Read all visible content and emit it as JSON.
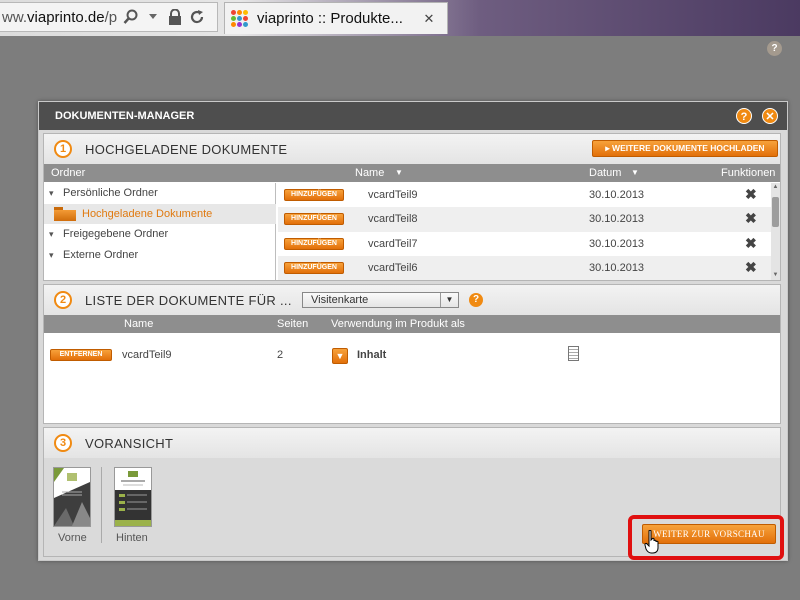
{
  "browser": {
    "url_prefix": "ww.",
    "url_host": "viaprinto.de",
    "url_rest": "/p",
    "tab_title": "viaprinto :: Produkte...",
    "tab_close": "✕"
  },
  "colors": {
    "accent_orange": "#f08a12",
    "title_bar": "#4e4e4e",
    "highlight_red": "#e01010"
  },
  "dialog": {
    "title": "DOKUMENTEN-MANAGER",
    "help_label": "?",
    "close_label": "✕"
  },
  "section1": {
    "number": "1",
    "title": "HOCHGELADENE DOKUMENTE",
    "upload_button": "WEITERE DOKUMENTE HOCHLADEN",
    "columns": {
      "folder": "Ordner",
      "name": "Name",
      "date": "Datum",
      "functions": "Funktionen"
    },
    "folders": [
      {
        "label": "Persönliche Ordner"
      },
      {
        "label": "Hochgeladene Dokumente"
      },
      {
        "label": "Freigegebene Ordner"
      },
      {
        "label": "Externe Ordner"
      }
    ],
    "documents": [
      {
        "action": "HINZUFÜGEN",
        "name": "vcardTeil9",
        "date": "30.10.2013"
      },
      {
        "action": "HINZUFÜGEN",
        "name": "vcardTeil8",
        "date": "30.10.2013"
      },
      {
        "action": "HINZUFÜGEN",
        "name": "vcardTeil7",
        "date": "30.10.2013"
      },
      {
        "action": "HINZUFÜGEN",
        "name": "vcardTeil6",
        "date": "30.10.2013"
      }
    ]
  },
  "section2": {
    "number": "2",
    "title": "LISTE DER DOKUMENTE FÜR ...",
    "product_select": "Visitenkarte",
    "help_label": "?",
    "columns": {
      "name": "Name",
      "pages": "Seiten",
      "usage": "Verwendung im Produkt als"
    },
    "rows": [
      {
        "action": "ENTFERNEN",
        "name": "vcardTeil9",
        "pages": "2",
        "usage": "Inhalt"
      }
    ]
  },
  "section3": {
    "number": "3",
    "title": "VORANSICHT",
    "previews": [
      {
        "label": "Vorne"
      },
      {
        "label": "Hinten"
      }
    ],
    "next_button": "WEITER ZUR VORSCHAU"
  }
}
